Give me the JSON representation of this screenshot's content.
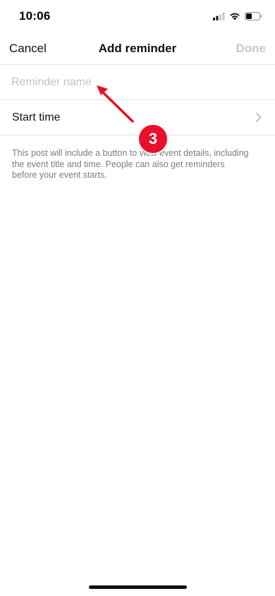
{
  "status_bar": {
    "time": "10:06",
    "signal_icon": "cellular-signal-icon",
    "wifi_icon": "wifi-icon",
    "battery_icon": "battery-icon"
  },
  "nav": {
    "cancel_label": "Cancel",
    "title": "Add reminder",
    "done_label": "Done"
  },
  "form": {
    "name_placeholder": "Reminder name",
    "name_value": "",
    "start_time_label": "Start time",
    "chevron_icon": "chevron-right-icon"
  },
  "info": {
    "text": "This post will include a button to view event details, including the event title and time. People can also get reminders before your event starts."
  },
  "annotation": {
    "step_number": "3",
    "color": "#e8102a"
  },
  "colors": {
    "background": "#ffffff",
    "divider": "#e6e6e6",
    "disabled_text": "#c8c8c8",
    "secondary_text": "#7d7d7d"
  }
}
